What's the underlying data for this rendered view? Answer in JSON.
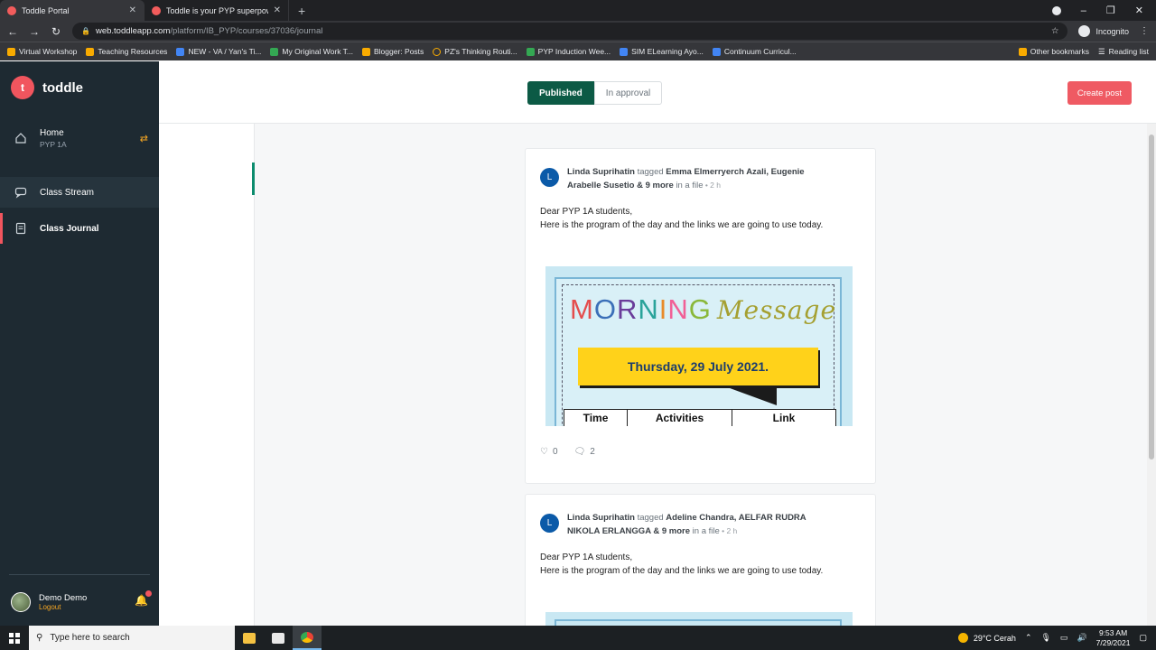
{
  "browser": {
    "tabs": [
      {
        "title": "Toddle Portal",
        "active": true
      },
      {
        "title": "Toddle is your PYP superpower f...",
        "active": false
      }
    ],
    "new_tab_icon": "+",
    "url_host": "web.toddleapp.com",
    "url_path": "/platform/IB_PYP/courses/37036/journal",
    "profile_label": "Incognito",
    "bookmarks": [
      "Virtual Workshop",
      "Teaching Resources",
      "NEW - VA / Yan's Ti...",
      "My Original Work T...",
      "Blogger: Posts",
      "PZ's Thinking Routi...",
      "PYP Induction Wee...",
      "SIM ELearning Ayo...",
      "Continuum Curricul..."
    ],
    "other_bookmarks": "Other bookmarks",
    "reading_list": "Reading list"
  },
  "sidebar": {
    "brand": "toddle",
    "brand_letter": "t",
    "home": {
      "label": "Home",
      "sub": "PYP 1A"
    },
    "class_stream": "Class Stream",
    "class_journal": "Class Journal",
    "user": {
      "name": "Demo Demo",
      "logout": "Logout"
    }
  },
  "header": {
    "tab_published": "Published",
    "tab_in_approval": "In approval",
    "create_post": "Create post"
  },
  "posts": [
    {
      "avatar": "L",
      "author": "Linda Suprihatin",
      "tagged_word": " tagged ",
      "tagged_names": "Emma Elmerryerch Azali, Eugenie Arabelle Susetio & 9 more",
      "in_file": " in a file",
      "time": " • 2 h",
      "line1": "Dear PYP 1A students,",
      "line2": "Here is the program of the day and the links we are going to use today.",
      "image": {
        "title_letters": [
          "M",
          "O",
          "R",
          "N",
          "I",
          "N",
          "G"
        ],
        "title_script": "Message",
        "date": "Thursday, 29 July 2021.",
        "columns": [
          "Time",
          "Activities",
          "Link"
        ]
      },
      "likes": "0",
      "comments": "2"
    },
    {
      "avatar": "L",
      "author": "Linda Suprihatin",
      "tagged_word": " tagged ",
      "tagged_names": "Adeline Chandra, AELFAR RUDRA NIKOLA ERLANGGA & 9 more",
      "in_file": " in a file",
      "time": " • 2 h",
      "line1": "Dear PYP 1A students,",
      "line2": "Here is the program of the day and the links we are going to use today."
    }
  ],
  "taskbar": {
    "search_placeholder": "Type here to search",
    "weather": "29°C  Cerah",
    "time": "9:53 AM",
    "date": "7/29/2021"
  },
  "colors": {
    "brand": "#f1555e",
    "published": "#0c5a45",
    "create_post": "#ef5a63",
    "sidebar_bg": "#1e2a32"
  }
}
